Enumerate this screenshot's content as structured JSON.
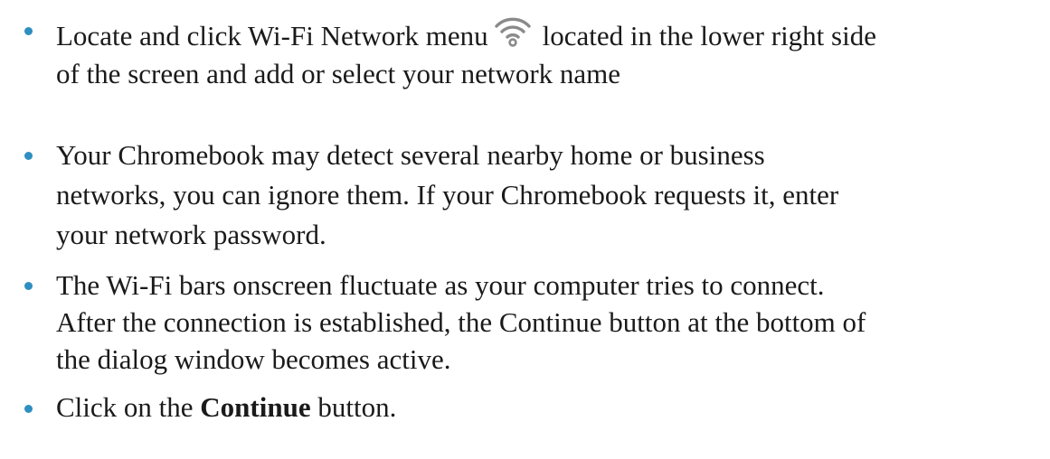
{
  "bullets": [
    {
      "lines": [
        "Locate and click Wi-Fi Network menu",
        "located in the lower right side",
        "of the screen and add or select your network name"
      ],
      "icon": "wifi-icon"
    },
    {
      "lines": [
        "Your Chromebook may detect several nearby home or business",
        "networks, you can ignore them. If your Chromebook requests it, enter",
        "your network password."
      ]
    },
    {
      "lines": [
        "The Wi-Fi bars onscreen fluctuate as your computer tries to connect.",
        "After the connection is established, the Continue button at the bottom of",
        "the dialog window becomes active."
      ]
    },
    {
      "prefix": "Click on the",
      "bold": "Continue",
      "suffix": "button."
    }
  ],
  "colors": {
    "bullet": "#2e8fc0",
    "text": "#1a1a1a",
    "icon": "#8a8a8a"
  }
}
